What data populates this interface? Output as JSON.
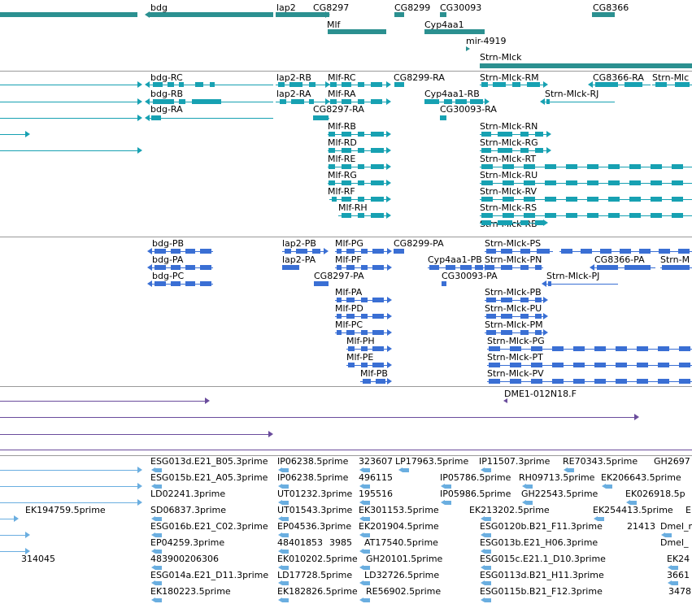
{
  "colors": {
    "gene": "#2b9090",
    "transcript": "#17a1b2",
    "protein": "#3a6fd4",
    "clone": "#6a4c9c",
    "est": "#6aaee0",
    "separator": "#9a9a9a"
  },
  "track_groups": [
    {
      "name": "genes",
      "features": [
        {
          "label": "bdg"
        },
        {
          "label": "lap2"
        },
        {
          "label": "CG8297"
        },
        {
          "label": "CG8299"
        },
        {
          "label": "CG30093"
        },
        {
          "label": "CG8366"
        },
        {
          "label": "Mlf"
        },
        {
          "label": "Cyp4aa1"
        },
        {
          "label": "mir-4919"
        },
        {
          "label": "Strn-Mlck"
        }
      ]
    },
    {
      "name": "transcripts",
      "features": [
        {
          "label": "bdg-RC"
        },
        {
          "label": "lap2-RB"
        },
        {
          "label": "Mlf-RC"
        },
        {
          "label": "CG8299-RA"
        },
        {
          "label": "Strn-Mlck-RM"
        },
        {
          "label": "CG8366-RA"
        },
        {
          "label": "Strn-Mlc"
        },
        {
          "label": "bdg-RB"
        },
        {
          "label": "lap2-RA"
        },
        {
          "label": "Mlf-RA"
        },
        {
          "label": "Cyp4aa1-RB"
        },
        {
          "label": "Strn-Mlck-RJ"
        },
        {
          "label": "bdg-RA"
        },
        {
          "label": "CG8297-RA"
        },
        {
          "label": "CG30093-RA"
        },
        {
          "label": "Mlf-RB"
        },
        {
          "label": "Strn-Mlck-RN"
        },
        {
          "label": "Mlf-RD"
        },
        {
          "label": "Strn-Mlck-RG"
        },
        {
          "label": "Mlf-RE"
        },
        {
          "label": "Strn-Mlck-RT"
        },
        {
          "label": "Mlf-RG"
        },
        {
          "label": "Strn-Mlck-RU"
        },
        {
          "label": "Mlf-RF"
        },
        {
          "label": "Strn-Mlck-RV"
        },
        {
          "label": "Mlf-RH"
        },
        {
          "label": "Strn-Mlck-RS"
        },
        {
          "label": "Strn-Mlck-RB"
        }
      ]
    },
    {
      "name": "proteins",
      "features": [
        {
          "label": "bdg-PB"
        },
        {
          "label": "lap2-PB"
        },
        {
          "label": "Mlf-PG"
        },
        {
          "label": "CG8299-PA"
        },
        {
          "label": "Strn-Mlck-PS"
        },
        {
          "label": "bdg-PA"
        },
        {
          "label": "lap2-PA"
        },
        {
          "label": "Mlf-PF"
        },
        {
          "label": "Cyp4aa1-PB"
        },
        {
          "label": "Strn-Mlck-PN"
        },
        {
          "label": "CG8366-PA"
        },
        {
          "label": "Strn-M"
        },
        {
          "label": "bdg-PC"
        },
        {
          "label": "CG8297-PA"
        },
        {
          "label": "CG30093-PA"
        },
        {
          "label": "Strn-Mlck-PJ"
        },
        {
          "label": "Mlf-PA"
        },
        {
          "label": "Strn-Mlck-PB"
        },
        {
          "label": "Mlf-PD"
        },
        {
          "label": "Strn-Mlck-PU"
        },
        {
          "label": "Mlf-PC"
        },
        {
          "label": "Strn-Mlck-PM"
        },
        {
          "label": "Mlf-PH"
        },
        {
          "label": "Strn-Mlck-PG"
        },
        {
          "label": "Mlf-PE"
        },
        {
          "label": "Strn-Mlck-PT"
        },
        {
          "label": "Mlf-PB"
        },
        {
          "label": "Strn-Mlck-PV"
        }
      ]
    },
    {
      "name": "clones",
      "features": [
        {
          "label": "DME1-012N18.F"
        }
      ]
    },
    {
      "name": "ests",
      "features": [
        {
          "label": "ESG013d.E21_B05.3prime"
        },
        {
          "label": "IP06238.5prime"
        },
        {
          "label": "323607"
        },
        {
          "label": "LP17963.5prime"
        },
        {
          "label": "IP11507.3prime"
        },
        {
          "label": "RE70343.5prime"
        },
        {
          "label": "GH2697"
        },
        {
          "label": "ESG015b.E21_A05.3prime"
        },
        {
          "label": "IP06238.5prime"
        },
        {
          "label": "496115"
        },
        {
          "label": "IP05786.5prime"
        },
        {
          "label": "RH09713.5prime"
        },
        {
          "label": "EK206643.5prime"
        },
        {
          "label": "LD02241.3prime"
        },
        {
          "label": "UT01232.3prime"
        },
        {
          "label": "195516"
        },
        {
          "label": "IP05986.5prime"
        },
        {
          "label": "GH22543.5prime"
        },
        {
          "label": "EK026918.5p"
        },
        {
          "label": "EK194759.5prime"
        },
        {
          "label": "SD06837.3prime"
        },
        {
          "label": "UT01543.3prime"
        },
        {
          "label": "EK301153.5prime"
        },
        {
          "label": "EK213202.5prime"
        },
        {
          "label": "EK254413.5prime"
        },
        {
          "label": "E"
        },
        {
          "label": "ESG016b.E21_C02.3prime"
        },
        {
          "label": "EP04536.3prime"
        },
        {
          "label": "EK201904.5prime"
        },
        {
          "label": "ESG0120b.B21_F11.3prime"
        },
        {
          "label": "21413"
        },
        {
          "label": "Dmel_m"
        },
        {
          "label": "EP04259.3prime"
        },
        {
          "label": "48401853"
        },
        {
          "label": "3985"
        },
        {
          "label": "AT17540.5prime"
        },
        {
          "label": "ESG013b.E21_H06.3prime"
        },
        {
          "label": "Dmel_"
        },
        {
          "label": "314045"
        },
        {
          "label": "483900206306"
        },
        {
          "label": "EK010202.5prime"
        },
        {
          "label": "GH20101.5prime"
        },
        {
          "label": "ESG015c.E21.1_D10.3prime"
        },
        {
          "label": "EK24"
        },
        {
          "label": "ESG014a.E21_D11.3prime"
        },
        {
          "label": "LD17728.5prime"
        },
        {
          "label": "LD32726.5prime"
        },
        {
          "label": "ESG0113d.B21_H11.3prime"
        },
        {
          "label": "3661"
        },
        {
          "label": "EK180223.5prime"
        },
        {
          "label": "EK182826.5prime"
        },
        {
          "label": "RE56902.5prime"
        },
        {
          "label": "ESG0115b.B21_F12.3prime"
        },
        {
          "label": "3478"
        }
      ]
    }
  ]
}
